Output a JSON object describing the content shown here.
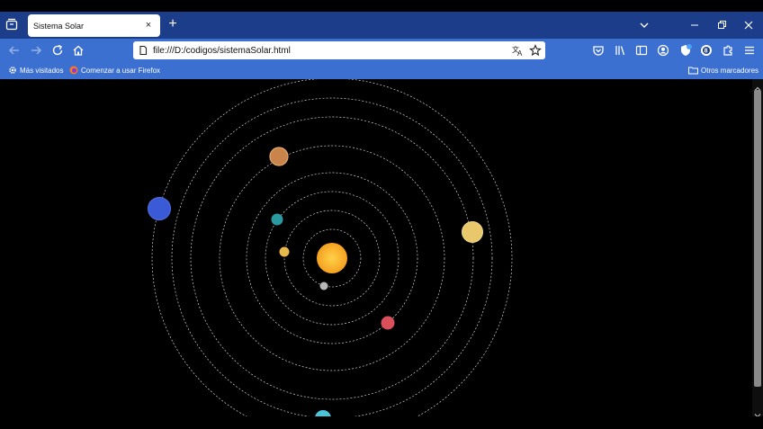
{
  "browser": {
    "tab_title": "Sistema Solar",
    "tab_close": "×",
    "new_tab": "+",
    "url": "file:///D:/codigos/sistemaSolar.html"
  },
  "bookmarks": {
    "most_visited": "Más visitados",
    "getting_started": "Comenzar a usar Firefox",
    "other_bookmarks": "Otros marcadores"
  },
  "colors": {
    "tabbar": "#1b3d8a",
    "toolbar": "#3b6fd0",
    "space": "#000000",
    "sun": "#f5a623",
    "orbit": "#cfcfcf"
  },
  "solar_system": {
    "planets": [
      {
        "name": "mercury",
        "color": "#b8b8b8"
      },
      {
        "name": "venus",
        "color": "#e8b84a"
      },
      {
        "name": "earth",
        "color": "#2a9aa0"
      },
      {
        "name": "mars",
        "color": "#d9505a"
      },
      {
        "name": "jupiter",
        "color": "#c8844a"
      },
      {
        "name": "saturn",
        "color": "#e8c86a"
      },
      {
        "name": "uranus",
        "color": "#4cc4d8"
      },
      {
        "name": "neptune",
        "color": "#3a5ad8"
      }
    ]
  }
}
